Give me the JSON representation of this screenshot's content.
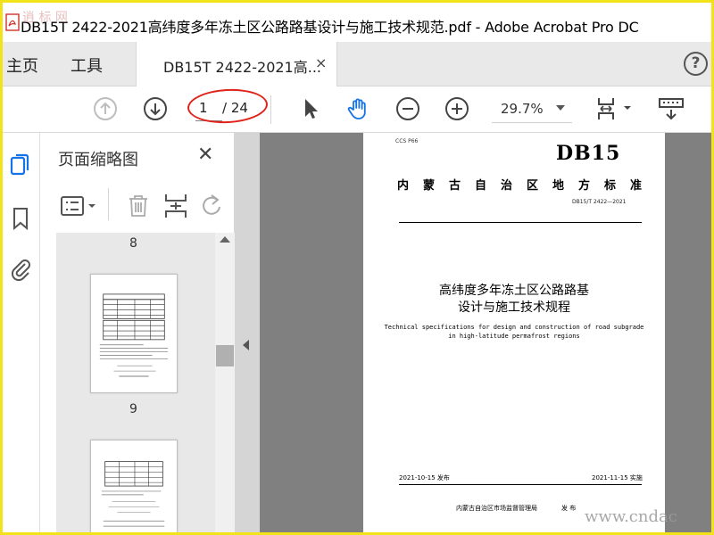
{
  "window": {
    "title": "DB15T 2422-2021高纬度多年冻土区公路路基设计与施工技术规范.pdf - Adobe Acrobat Pro DC"
  },
  "tabs": {
    "home": "主页",
    "tools": "工具",
    "document": "DB15T 2422-2021高...",
    "close": "×",
    "help": "?"
  },
  "toolbar": {
    "page_current": "1",
    "page_total": "/ 24",
    "zoom": "29.7%"
  },
  "thumbnails_panel": {
    "title": "页面缩略图",
    "close": "✕",
    "labels": [
      "8",
      "9"
    ]
  },
  "document": {
    "ccs": "CCS P66",
    "code": "DB15",
    "org": "内蒙古自治区地方标准",
    "number": "DB15/T 2422—2021",
    "title_line1": "高纬度多年冻土区公路路基",
    "title_line2": "设计与施工技术规程",
    "english_line1": "Technical specifications for design and construction of road subgrade",
    "english_line2": "in high-latitude permafrost regions",
    "release_date": "2021-10-15 发布",
    "implement_date": "2021-11-15 实施",
    "publisher": "内蒙古自治区市场监督管理局",
    "publish_word": "发 布"
  },
  "watermarks": {
    "top_left": "逍 标 网",
    "bottom_right": "www.cndac"
  },
  "colors": {
    "accent_blue": "#1473e6",
    "highlight_oval": "#e0231a",
    "frame_yellow": "#f2e21a"
  },
  "icons": [
    "app-pdf-icon",
    "page-up-icon",
    "page-down-icon",
    "select-arrow-icon",
    "hand-icon",
    "zoom-out-icon",
    "zoom-in-icon",
    "fit-page-icon",
    "scroll-mode-icon",
    "thumbnails-icon",
    "bookmark-icon",
    "attachment-icon",
    "options-icon",
    "delete-icon",
    "insert-page-icon",
    "rotate-icon"
  ]
}
